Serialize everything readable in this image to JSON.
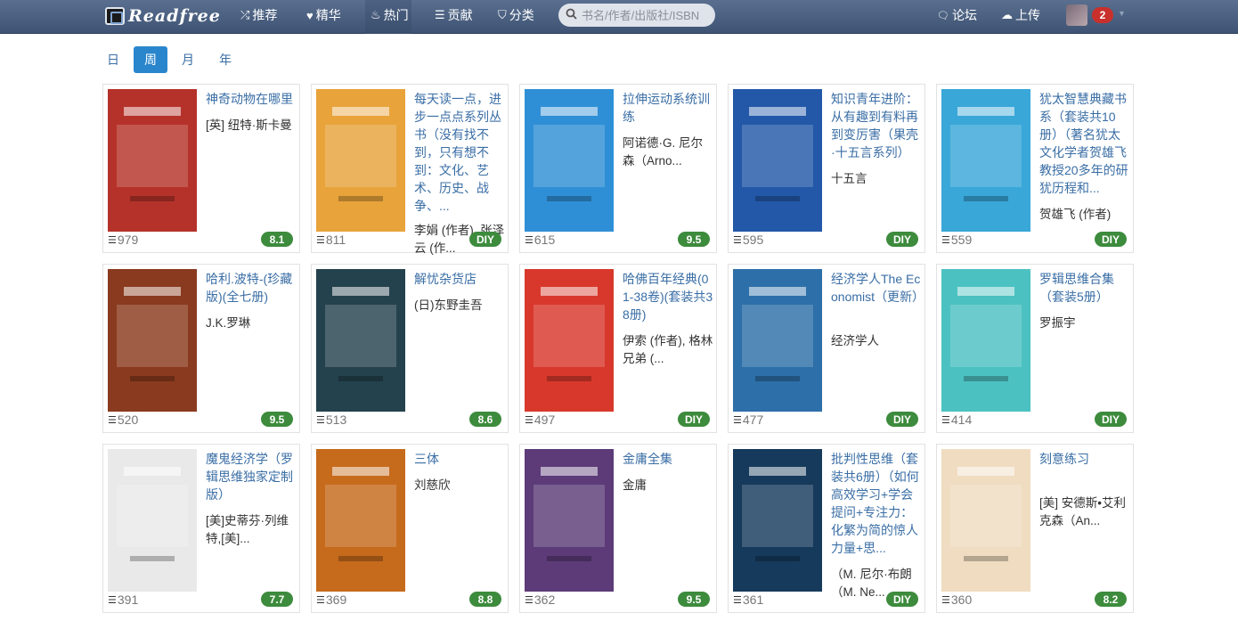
{
  "navbar": {
    "brand": "Readfree",
    "items": [
      {
        "label": "推荐",
        "icon": "shuffle-icon",
        "glyph": "⤮"
      },
      {
        "label": "精华",
        "icon": "heart-icon",
        "glyph": "♥"
      },
      {
        "label": "热门",
        "icon": "fire-icon",
        "glyph": "♨"
      },
      {
        "label": "贡献",
        "icon": "list-icon",
        "glyph": "☰"
      },
      {
        "label": "分类",
        "icon": "tags-icon",
        "glyph": "⛉"
      }
    ],
    "search_placeholder": "书名/作者/出版社/ISBN",
    "forum": {
      "label": "论坛",
      "icon": "comments-icon",
      "glyph": "🗨"
    },
    "upload": {
      "label": "上传",
      "icon": "cloud-upload-icon",
      "glyph": "☁"
    },
    "notification_count": "2"
  },
  "period_tabs": [
    {
      "label": "日",
      "active": false
    },
    {
      "label": "周",
      "active": true
    },
    {
      "label": "月",
      "active": false
    },
    {
      "label": "年",
      "active": false
    }
  ],
  "books": [
    {
      "title": "神奇动物在哪里",
      "author": "[英] 纽特·斯卡曼",
      "count": "979",
      "badge": "8.1",
      "cover_color": "#b5322a"
    },
    {
      "title": "每天读一点，进步一点点系列丛书（没有找不到，只有想不到：文化、艺术、历史、战争、...",
      "author": "李娟 (作者), 张泽云 (作...",
      "count": "811",
      "badge": "DIY",
      "cover_color": "#e8a33b"
    },
    {
      "title": "拉伸运动系统训练",
      "author": "阿诺德·G. 尼尔森（Arno...",
      "count": "615",
      "badge": "9.5",
      "cover_color": "#2f8fd6"
    },
    {
      "title": "知识青年进阶：从有趣到有料再到变厉害（果壳·十五言系列）",
      "author": "十五言",
      "count": "595",
      "badge": "DIY",
      "cover_color": "#2358a8"
    },
    {
      "title": "犹太智慧典藏书系（套装共10册）（著名犹太文化学者贺雄飞教授20多年的研犹历程和...",
      "author": "贺雄飞 (作者)",
      "count": "559",
      "badge": "DIY",
      "cover_color": "#39a7d8"
    },
    {
      "title": "哈利.波特-(珍藏版)(全七册)",
      "author": "J.K.罗琳",
      "count": "520",
      "badge": "9.5",
      "cover_color": "#8a3a1e"
    },
    {
      "title": "解忧杂货店",
      "author": "(日)东野圭吾",
      "count": "513",
      "badge": "8.6",
      "cover_color": "#24424d"
    },
    {
      "title": "哈佛百年经典(01-38卷)(套装共38册)",
      "author": "伊索 (作者), 格林兄弟 (...",
      "count": "497",
      "badge": "DIY",
      "cover_color": "#d8382b"
    },
    {
      "title": "经济学人The Economist（更新）",
      "author": "经济学人",
      "count": "477",
      "badge": "DIY",
      "cover_color": "#2d6fa8"
    },
    {
      "title": "罗辑思维合集（套装5册）",
      "author": "罗振宇",
      "count": "414",
      "badge": "DIY",
      "cover_color": "#4cc1c2"
    },
    {
      "title": "魔鬼经济学（罗辑思维独家定制版）",
      "author": "[美]史蒂芬·列维特,[美]...",
      "count": "391",
      "badge": "7.7",
      "cover_color": "#e9e9e9"
    },
    {
      "title": "三体",
      "author": "刘慈欣",
      "count": "369",
      "badge": "8.8",
      "cover_color": "#c66a1c"
    },
    {
      "title": "金庸全集",
      "author": "金庸",
      "count": "362",
      "badge": "9.5",
      "cover_color": "#5c3b78"
    },
    {
      "title": "批判性思维（套装共6册）（如何高效学习+学会提问+专注力：化繁为简的惊人力量+思...",
      "author": "（M. 尼尔·布朗（M. Ne...",
      "count": "361",
      "badge": "DIY",
      "cover_color": "#163a5c"
    },
    {
      "title": "刻意练习",
      "author": "[美] 安德斯•艾利克森（An...",
      "count": "360",
      "badge": "8.2",
      "cover_color": "#f0dcc0"
    }
  ]
}
